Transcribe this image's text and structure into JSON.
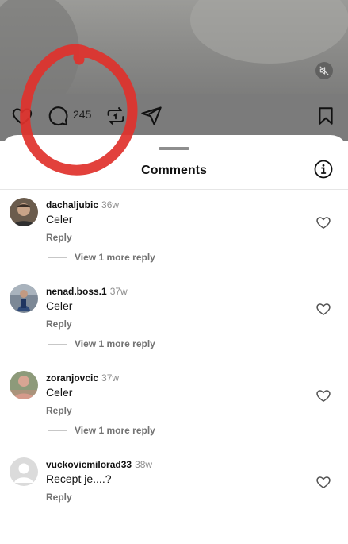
{
  "post_actions": {
    "comment_count": "245",
    "icons": [
      "heart-icon",
      "comment-icon",
      "repost-icon",
      "share-icon",
      "bookmark-icon",
      "mute-icon"
    ]
  },
  "sheet": {
    "title": "Comments"
  },
  "comments": [
    {
      "username": "dachaljubic",
      "time": "36w",
      "text": "Celer",
      "reply_label": "Reply",
      "view_more": "View 1 more reply",
      "avatar_color": "#5a4a3e"
    },
    {
      "username": "nenad.boss.1",
      "time": "37w",
      "text": "Celer",
      "reply_label": "Reply",
      "view_more": "View 1 more reply",
      "avatar_color": "#4b5a72"
    },
    {
      "username": "zoranjovcic",
      "time": "37w",
      "text": "Celer",
      "reply_label": "Reply",
      "view_more": "View 1 more reply",
      "avatar_color": "#9a6a5a"
    },
    {
      "username": "vuckovicmilorad33",
      "time": "38w",
      "text": "Recept je....?",
      "reply_label": "Reply",
      "avatar_color": "#c7c7c7"
    }
  ],
  "colors": {
    "annotation": "#e0312b",
    "overlay": "#7b7b7b"
  }
}
